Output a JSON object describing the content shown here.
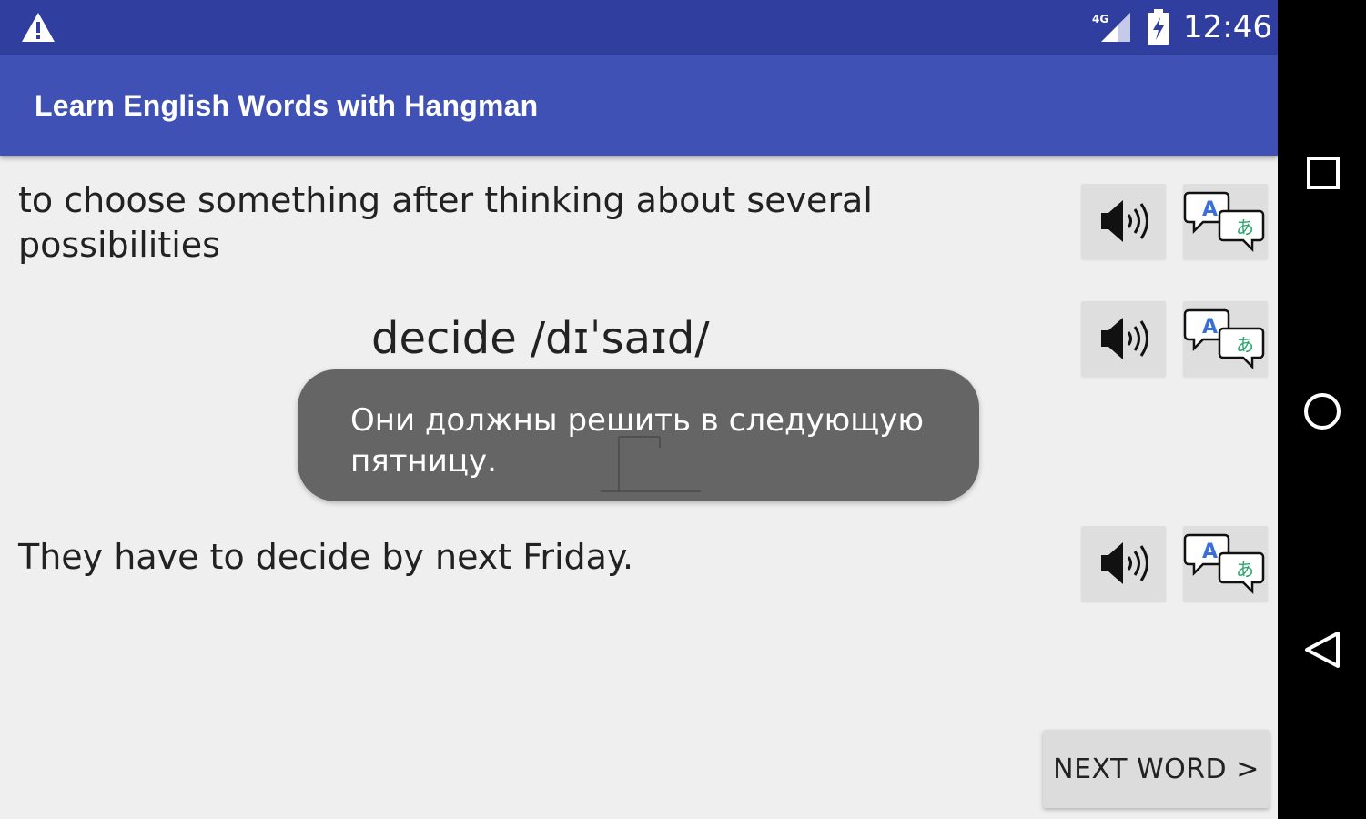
{
  "status_bar": {
    "network_label": "4G",
    "time": "12:46",
    "icons": [
      "warning-icon",
      "cellular-signal-icon",
      "battery-charging-icon"
    ]
  },
  "app_bar": {
    "title": "Learn English Words with Hangman"
  },
  "content": {
    "definition": "to choose something after thinking about several possibilities",
    "word": "decide /dɪˈsaɪd/",
    "example": "They have to decide by next Friday.",
    "row_actions": [
      "speaker-icon",
      "translate-icon"
    ],
    "next_button_label": "NEXT WORD >"
  },
  "toast": {
    "text": "Они должны решить в следующую пятницу."
  },
  "nav_bar": {
    "buttons": [
      "recents-square-icon",
      "home-circle-icon",
      "back-triangle-icon"
    ]
  },
  "colors": {
    "status_bar": "#303f9f",
    "app_bar": "#3f51b5",
    "background": "#efefef",
    "toast": "#656565",
    "translate_a": "#3b6fd8",
    "translate_jp": "#2aa66c"
  }
}
